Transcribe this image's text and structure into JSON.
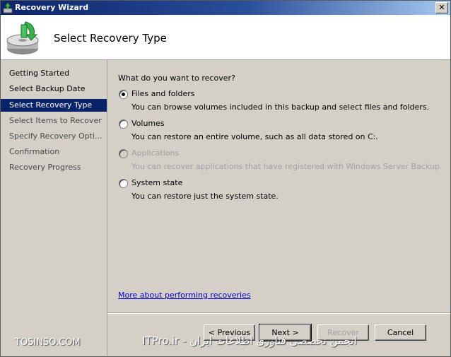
{
  "window": {
    "title": "Recovery Wizard",
    "close_symbol": "✕"
  },
  "header": {
    "title": "Select Recovery Type",
    "icon": "backup-restore-icon"
  },
  "sidebar": {
    "items": [
      {
        "label": "Getting Started",
        "state": "done"
      },
      {
        "label": "Select Backup Date",
        "state": "done"
      },
      {
        "label": "Select Recovery Type",
        "state": "active"
      },
      {
        "label": "Select Items to Recover",
        "state": "pending"
      },
      {
        "label": "Specify Recovery Opti...",
        "state": "pending"
      },
      {
        "label": "Confirmation",
        "state": "pending"
      },
      {
        "label": "Recovery Progress",
        "state": "pending"
      }
    ]
  },
  "main": {
    "question": "What do you want to recover?",
    "options": [
      {
        "label": "Files and folders",
        "description": "You can browse volumes included in this backup and select files and folders.",
        "selected": true,
        "enabled": true
      },
      {
        "label": "Volumes",
        "description": "You can restore an entire volume, such as all data stored on C:.",
        "selected": false,
        "enabled": true
      },
      {
        "label": "Applications",
        "description": "You can recover applications that have registered with Windows Server Backup.",
        "selected": false,
        "enabled": false
      },
      {
        "label": "System state",
        "description": "You can restore just the system state.",
        "selected": false,
        "enabled": true
      }
    ],
    "help_link": "More about performing recoveries"
  },
  "buttons": {
    "previous": "< Previous",
    "next": "Next >",
    "recover": "Recover",
    "cancel": "Cancel"
  },
  "watermark": {
    "left": "TOSINSO.COM",
    "right": "انجمن تخصصی فناوری اطلاعات ایران - ITPro.ir"
  }
}
